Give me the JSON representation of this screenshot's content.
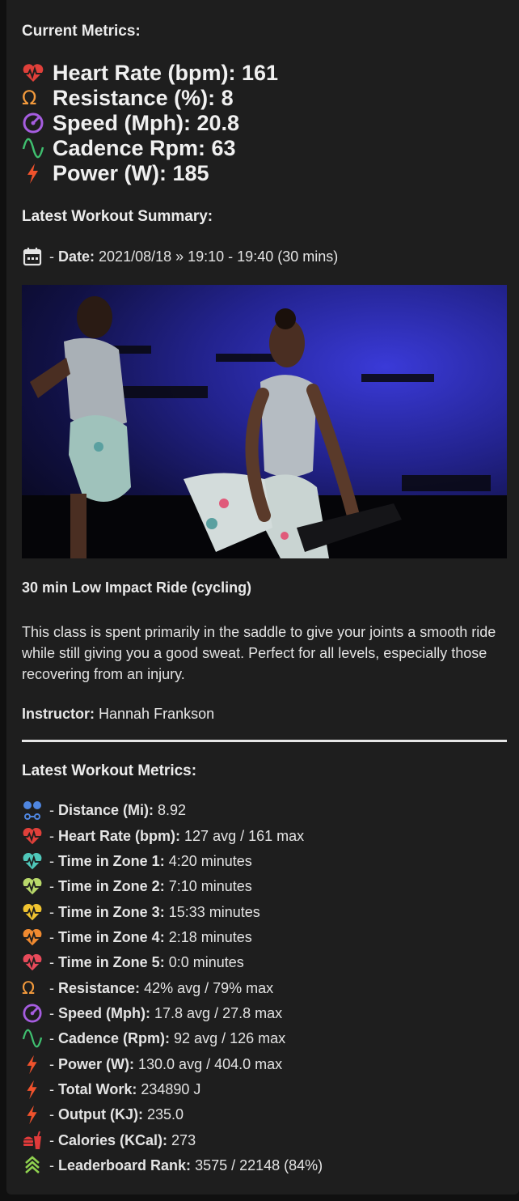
{
  "current": {
    "title": "Current Metrics:",
    "items": [
      {
        "icon": "heart-icon",
        "color": "#e0403a",
        "text": "Heart Rate (bpm): 161"
      },
      {
        "icon": "omega-icon",
        "color": "#f39a3c",
        "text": "Resistance (%): 8"
      },
      {
        "icon": "speedometer-icon",
        "color": "#a65de0",
        "text": "Speed (Mph): 20.8"
      },
      {
        "icon": "sine-wave-icon",
        "color": "#3fbf6f",
        "text": "Cadence Rpm: 63"
      },
      {
        "icon": "lightning-icon",
        "color": "#f0522c",
        "text": "Power (W): 185"
      }
    ]
  },
  "summary": {
    "title": "Latest Workout Summary:",
    "date_label": "Date:",
    "date_prefix": "- ",
    "date_value": "2021/08/18 » 19:10 - 19:40 (30 mins)",
    "class_title": "30 min Low Impact Ride (cycling)",
    "description": "This class is spent primarily in the saddle to give your joints a smooth ride while still giving you a good sweat. Perfect for all levels, especially those recovering from an injury.",
    "instructor_label": "Instructor:",
    "instructor_name": "Hannah Frankson"
  },
  "metrics": {
    "title": "Latest Workout Metrics:",
    "items": [
      {
        "icon": "distance-icon",
        "color": "#4f86e0",
        "label": "Distance (Mi):",
        "value": "8.92"
      },
      {
        "icon": "heart-icon",
        "color": "#e0403a",
        "label": "Heart Rate (bpm):",
        "value": "127 avg / 161 max"
      },
      {
        "icon": "heart-pulse-zone1-icon",
        "color": "#4fc7b9",
        "label": "Time in Zone 1:",
        "value": "4:20 minutes"
      },
      {
        "icon": "heart-pulse-zone2-icon",
        "color": "#b8d86a",
        "label": "Time in Zone 2:",
        "value": "7:10 minutes"
      },
      {
        "icon": "heart-pulse-zone3-icon",
        "color": "#f0c330",
        "label": "Time in Zone 3:",
        "value": "15:33 minutes"
      },
      {
        "icon": "heart-pulse-zone4-icon",
        "color": "#f08a30",
        "label": "Time in Zone 4:",
        "value": "2:18 minutes"
      },
      {
        "icon": "heart-pulse-zone5-icon",
        "color": "#e84a5a",
        "label": "Time in Zone 5:",
        "value": "0:0 minutes"
      },
      {
        "icon": "omega-icon",
        "color": "#f39a3c",
        "label": "Resistance:",
        "value": "42% avg / 79% max"
      },
      {
        "icon": "speedometer-icon",
        "color": "#a65de0",
        "label": "Speed (Mph):",
        "value": "17.8 avg / 27.8 max"
      },
      {
        "icon": "sine-wave-icon",
        "color": "#3fbf6f",
        "label": "Cadence (Rpm):",
        "value": "92 avg / 126 max"
      },
      {
        "icon": "lightning-icon",
        "color": "#f0522c",
        "label": "Power (W):",
        "value": "130.0 avg / 404.0 max"
      },
      {
        "icon": "lightning-icon",
        "color": "#f0522c",
        "label": "Total Work:",
        "value": "234890 J"
      },
      {
        "icon": "lightning-icon",
        "color": "#f0522c",
        "label": "Output (KJ):",
        "value": "235.0"
      },
      {
        "icon": "food-drink-icon",
        "color": "#e03a3a",
        "label": "Calories (KCal):",
        "value": "273"
      },
      {
        "icon": "rank-chevrons-icon",
        "color": "#8fd14f",
        "label": "Leaderboard Rank:",
        "value": "3575 / 22148 (84%)"
      }
    ]
  }
}
